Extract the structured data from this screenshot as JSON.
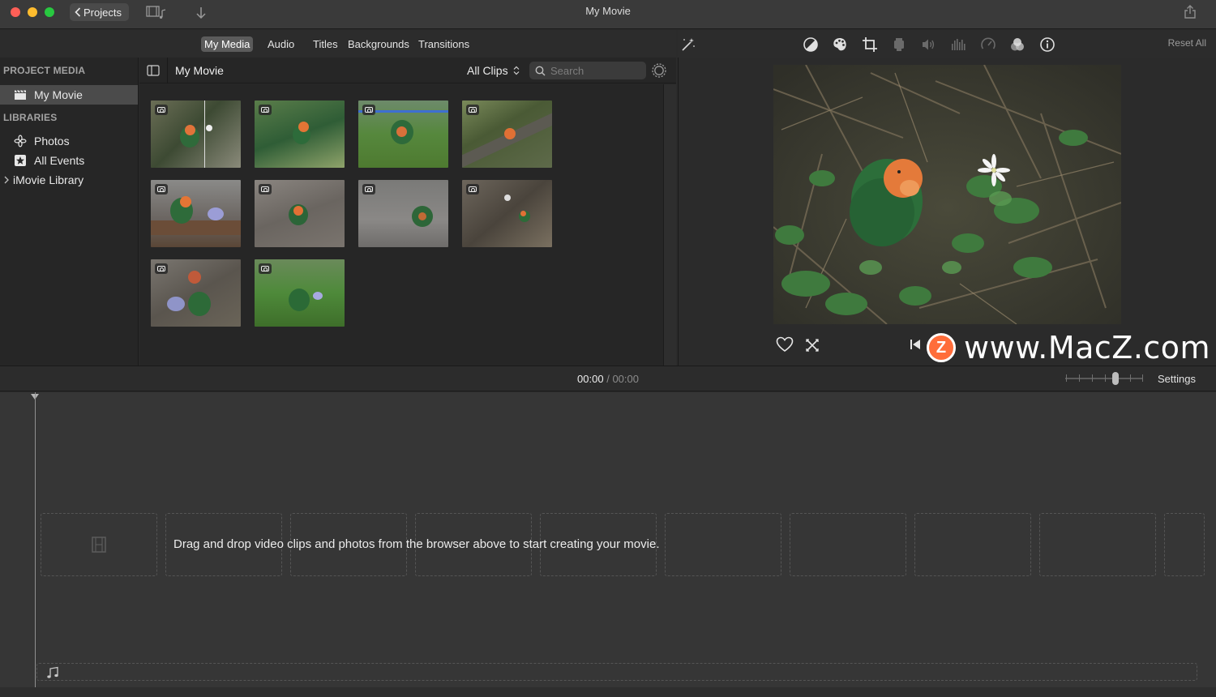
{
  "window": {
    "title": "My Movie",
    "projects_label": "Projects"
  },
  "browser_tabs": [
    "My Media",
    "Audio",
    "Titles",
    "Backgrounds",
    "Transitions"
  ],
  "active_tab": "My Media",
  "viewer_toolbar": {
    "tools": [
      "magic-wand",
      "color-balance",
      "color-correction",
      "crop",
      "stabilization",
      "volume",
      "noise-reduction-equalizer",
      "speed",
      "clip-filter",
      "info"
    ],
    "reset_label": "Reset All"
  },
  "sidebar": {
    "project_media_header": "PROJECT MEDIA",
    "project_item": "My Movie",
    "libraries_header": "LIBRARIES",
    "libraries": [
      {
        "label": "Photos",
        "icon": "photos-icon"
      },
      {
        "label": "All Events",
        "icon": "star-icon"
      },
      {
        "label": "iMovie Library",
        "icon": "disclosure-icon"
      }
    ]
  },
  "browser": {
    "title": "My Movie",
    "filter": "All Clips",
    "search_placeholder": "Search",
    "thumbnail_count": 10
  },
  "timeline": {
    "current_time": "00:00",
    "separator": "/",
    "total_time": "00:00",
    "settings_label": "Settings",
    "zoom_level": 0.6,
    "drop_message": "Drag and drop video clips and photos from the browser above to start creating your movie."
  },
  "watermark": {
    "text": "www.MacZ.com",
    "logo_letter": "Z"
  },
  "colors": {
    "close": "#fe5f57",
    "minimize": "#febc2e",
    "maximize": "#28c840",
    "active_tab_bg": "#5b5b5b",
    "selected_row_bg": "#4b4b4b"
  }
}
